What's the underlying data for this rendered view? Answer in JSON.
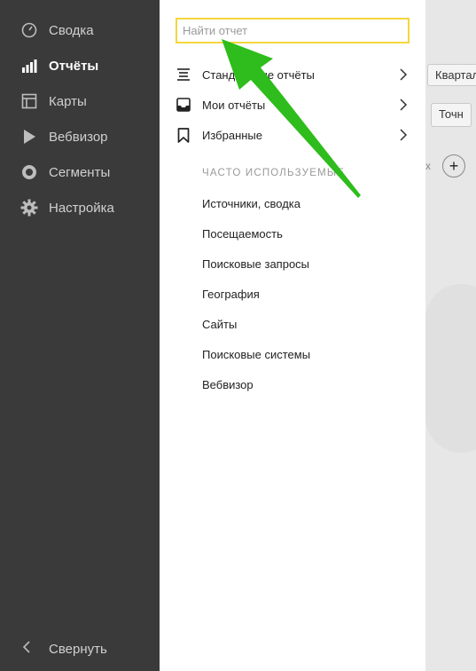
{
  "sidebar": {
    "items": [
      {
        "label": "Сводка",
        "icon": "gauge-icon"
      },
      {
        "label": "Отчёты",
        "icon": "bar-chart-icon",
        "active": true
      },
      {
        "label": "Карты",
        "icon": "layout-icon"
      },
      {
        "label": "Вебвизор",
        "icon": "play-icon"
      },
      {
        "label": "Сегменты",
        "icon": "pie-icon"
      },
      {
        "label": "Настройка",
        "icon": "gear-icon"
      }
    ],
    "collapse_label": "Свернуть"
  },
  "panel": {
    "search": {
      "placeholder": "Найти отчет",
      "value": ""
    },
    "menu": [
      {
        "label": "Стандартные отчёты",
        "icon": "list-icon"
      },
      {
        "label": "Мои отчёты",
        "icon": "inbox-icon"
      },
      {
        "label": "Избранные",
        "icon": "bookmark-icon"
      }
    ],
    "section_title": "ЧАСТО ИСПОЛЬЗУЕМЫЕ",
    "frequent": [
      "Источники, сводка",
      "Посещаемость",
      "Поисковые запросы",
      "География",
      "Сайты",
      "Поисковые системы",
      "Вебвизор"
    ]
  },
  "background": {
    "button_1": "Квартал",
    "button_2": "Точн",
    "fragment": "х",
    "plus": "+"
  },
  "colors": {
    "sidebar": "#3a3a3a",
    "search_border": "#f5d63d",
    "arrow": "#2ebd1c"
  }
}
